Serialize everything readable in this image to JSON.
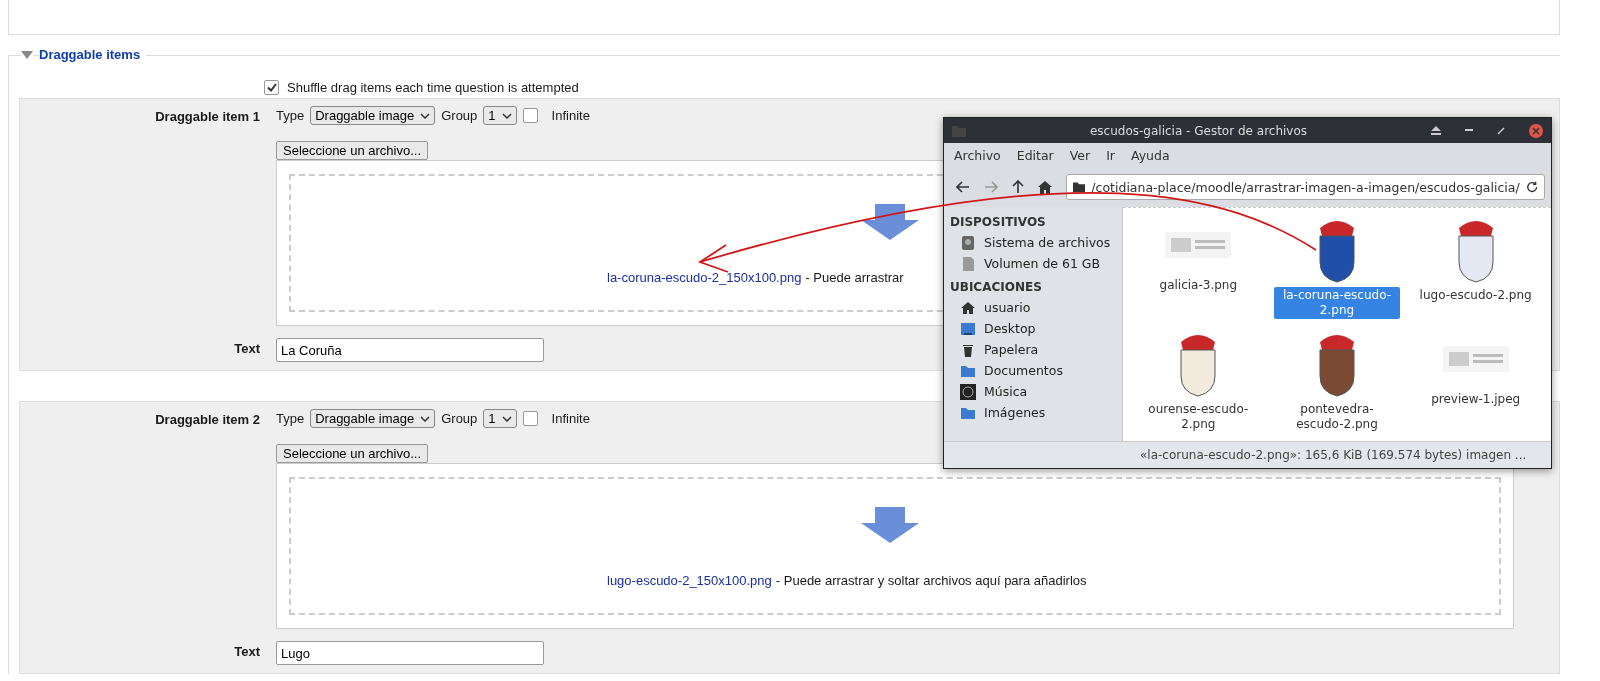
{
  "section": {
    "title": "Draggable items",
    "expanded": true,
    "shuffle": {
      "label": "Shuffle drag items each time question is attempted",
      "checked": true
    }
  },
  "items": [
    {
      "label": "Draggable item 1",
      "type_label": "Type",
      "type_value": "Draggable image",
      "group_label": "Group",
      "group_value": "1",
      "infinite": {
        "label": "Infinite",
        "checked": false
      },
      "file_button": "Seleccione un archivo...",
      "file_link": "la-coruna-escudo-2_150x100.png",
      "drop_hint": "- Puede arrastrar",
      "text_label": "Text",
      "text_value": "La Coruña"
    },
    {
      "label": "Draggable item 2",
      "type_label": "Type",
      "type_value": "Draggable image",
      "group_label": "Group",
      "group_value": "1",
      "infinite": {
        "label": "Infinite",
        "checked": false
      },
      "file_button": "Seleccione un archivo...",
      "file_link": "lugo-escudo-2_150x100.png",
      "drop_hint": "- Puede arrastrar y soltar archivos aquí para añadirlos",
      "text_label": "Text",
      "text_value": "Lugo"
    }
  ],
  "file_manager": {
    "title": "escudos-galicia - Gestor de archivos",
    "menu": [
      "Archivo",
      "Editar",
      "Ver",
      "Ir",
      "Ayuda"
    ],
    "path": "/cotidiana-place/moodle/arrastrar-imagen-a-imagen/escudos-galicia/",
    "sidebar": [
      {
        "heading": "DISPOSITIVOS",
        "items": [
          {
            "label": "Sistema de archivos",
            "kind": "drive"
          },
          {
            "label": "Volumen de 61 GB",
            "kind": "volume"
          }
        ]
      },
      {
        "heading": "UBICACIONES",
        "items": [
          {
            "label": "usuario",
            "kind": "home"
          },
          {
            "label": "Desktop",
            "kind": "desktop"
          },
          {
            "label": "Papelera",
            "kind": "trash"
          },
          {
            "label": "Documentos",
            "kind": "folder"
          },
          {
            "label": "Música",
            "kind": "music"
          },
          {
            "label": "Imágenes",
            "kind": "folder"
          }
        ]
      }
    ],
    "files": [
      {
        "name": "galicia-3.png",
        "kind": "screenshot",
        "selected": false
      },
      {
        "name": "la-coruna-escudo-2.png",
        "kind": "crest",
        "color": "#1f4fa8",
        "selected": true
      },
      {
        "name": "lugo-escudo-2.png",
        "kind": "crest",
        "color": "#e4e8f2",
        "selected": false
      },
      {
        "name": "ourense-escudo-2.png",
        "kind": "crest",
        "color": "#f2eadc",
        "selected": false
      },
      {
        "name": "pontevedra-escudo-2.png",
        "kind": "crest",
        "color": "#7a4a32",
        "selected": false
      },
      {
        "name": "preview-1.jpeg",
        "kind": "screenshot",
        "selected": false
      }
    ],
    "status": "«la-coruna-escudo-2.png»: 165,6 KiB (169.574 bytes) imagen ..."
  }
}
